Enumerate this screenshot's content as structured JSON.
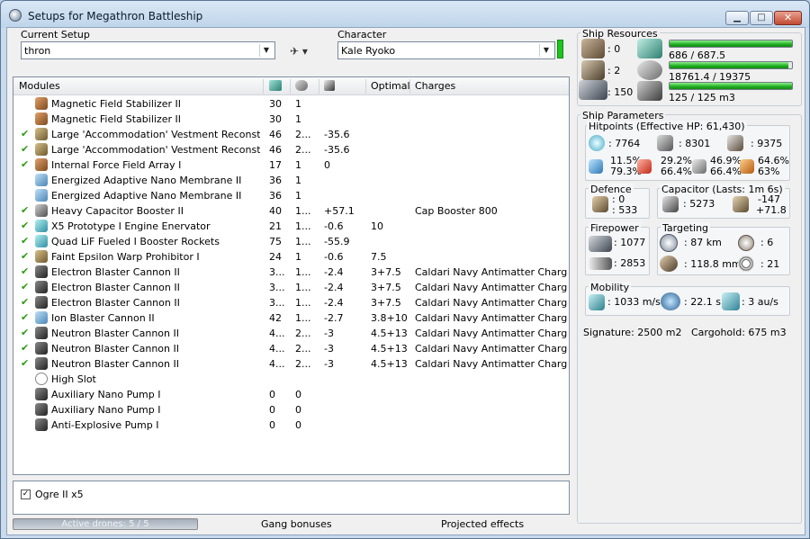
{
  "window": {
    "title": "Setups for Megathron Battleship",
    "min_glyph": "▁",
    "max_glyph": "□",
    "close_glyph": "✕"
  },
  "setup": {
    "label": "Current Setup",
    "value": "thron",
    "tool_glyph": "✈ ▾"
  },
  "character": {
    "label": "Character",
    "value": "Kale Ryoko"
  },
  "modules": {
    "headers": {
      "name": "Modules",
      "optimal": "Optimal",
      "charges": "Charges"
    },
    "rows": [
      {
        "checked": false,
        "icon": "ic-brown",
        "name": "Magnetic Field Stabilizer II",
        "c1": "30",
        "c2": "1",
        "c3": "",
        "optimal": "",
        "charges": ""
      },
      {
        "checked": false,
        "icon": "ic-brown",
        "name": "Magnetic Field Stabilizer II",
        "c1": "30",
        "c2": "1",
        "c3": "",
        "optimal": "",
        "charges": ""
      },
      {
        "checked": true,
        "icon": "ic-tan",
        "name": "Large 'Accommodation' Vestment Reconstructer I",
        "c1": "46",
        "c2": "2...",
        "c3": "-35.6",
        "optimal": "",
        "charges": ""
      },
      {
        "checked": true,
        "icon": "ic-tan",
        "name": "Large 'Accommodation' Vestment Reconstructer I",
        "c1": "46",
        "c2": "2...",
        "c3": "-35.6",
        "optimal": "",
        "charges": ""
      },
      {
        "checked": true,
        "icon": "ic-brown",
        "name": "Internal Force Field Array I",
        "c1": "17",
        "c2": "1",
        "c3": "0",
        "optimal": "",
        "charges": ""
      },
      {
        "checked": false,
        "icon": "ic-blue",
        "name": "Energized Adaptive Nano Membrane II",
        "c1": "36",
        "c2": "1",
        "c3": "",
        "optimal": "",
        "charges": ""
      },
      {
        "checked": false,
        "icon": "ic-blue",
        "name": "Energized Adaptive Nano Membrane II",
        "c1": "36",
        "c2": "1",
        "c3": "",
        "optimal": "",
        "charges": ""
      },
      {
        "checked": true,
        "icon": "ic-grey",
        "name": "Heavy Capacitor Booster II",
        "c1": "40",
        "c2": "1...",
        "c3": "+57.1",
        "optimal": "",
        "charges": "Cap Booster 800"
      },
      {
        "checked": true,
        "icon": "ic-teal",
        "name": "X5 Prototype I Engine Enervator",
        "c1": "21",
        "c2": "1...",
        "c3": "-0.6",
        "optimal": "10",
        "charges": ""
      },
      {
        "checked": true,
        "icon": "ic-teal",
        "name": "Quad LiF Fueled I Booster Rockets",
        "c1": "75",
        "c2": "1...",
        "c3": "-55.9",
        "optimal": "",
        "charges": ""
      },
      {
        "checked": true,
        "icon": "ic-tan",
        "name": "Faint Epsilon Warp Prohibitor I",
        "c1": "24",
        "c2": "1",
        "c3": "-0.6",
        "optimal": "7.5",
        "charges": ""
      },
      {
        "checked": true,
        "icon": "ic-dark",
        "name": "Electron Blaster Cannon II",
        "c1": "3...",
        "c2": "1...",
        "c3": "-2.4",
        "optimal": "3+7.5",
        "charges": "Caldari Navy Antimatter Charge L"
      },
      {
        "checked": true,
        "icon": "ic-dark",
        "name": "Electron Blaster Cannon II",
        "c1": "3...",
        "c2": "1...",
        "c3": "-2.4",
        "optimal": "3+7.5",
        "charges": "Caldari Navy Antimatter Charge L"
      },
      {
        "checked": true,
        "icon": "ic-dark",
        "name": "Electron Blaster Cannon II",
        "c1": "3...",
        "c2": "1...",
        "c3": "-2.4",
        "optimal": "3+7.5",
        "charges": "Caldari Navy Antimatter Charge L"
      },
      {
        "checked": true,
        "icon": "ic-blue",
        "name": "Ion Blaster Cannon II",
        "c1": "42",
        "c2": "1...",
        "c3": "-2.7",
        "optimal": "3.8+10",
        "charges": "Caldari Navy Antimatter Charge L"
      },
      {
        "checked": true,
        "icon": "ic-dark",
        "name": "Neutron Blaster Cannon II",
        "c1": "4...",
        "c2": "2...",
        "c3": "-3",
        "optimal": "4.5+13",
        "charges": "Caldari Navy Antimatter Charge L"
      },
      {
        "checked": true,
        "icon": "ic-dark",
        "name": "Neutron Blaster Cannon II",
        "c1": "4...",
        "c2": "2...",
        "c3": "-3",
        "optimal": "4.5+13",
        "charges": "Caldari Navy Antimatter Charge L"
      },
      {
        "checked": true,
        "icon": "ic-dark",
        "name": "Neutron Blaster Cannon II",
        "c1": "4...",
        "c2": "2...",
        "c3": "-3",
        "optimal": "4.5+13",
        "charges": "Caldari Navy Antimatter Charge L"
      },
      {
        "checked": false,
        "icon": "ic-slot",
        "name": "High Slot",
        "c1": "",
        "c2": "",
        "c3": "",
        "optimal": "",
        "charges": ""
      },
      {
        "checked": false,
        "icon": "ic-dark",
        "name": "Auxiliary Nano Pump I",
        "c1": "0",
        "c2": "0",
        "c3": "",
        "optimal": "",
        "charges": ""
      },
      {
        "checked": false,
        "icon": "ic-dark",
        "name": "Auxiliary Nano Pump I",
        "c1": "0",
        "c2": "0",
        "c3": "",
        "optimal": "",
        "charges": ""
      },
      {
        "checked": false,
        "icon": "ic-dark",
        "name": "Anti-Explosive Pump I",
        "c1": "0",
        "c2": "0",
        "c3": "",
        "optimal": "",
        "charges": ""
      }
    ]
  },
  "drones": {
    "item": "Ogre II x5",
    "checked_glyph": "✓"
  },
  "status": {
    "active_drones": "Active drones: 5 / 5",
    "active_drones_fraction": 1.0,
    "gang": "Gang bonuses",
    "projected": "Projected effects"
  },
  "resources": {
    "title": "Ship Resources",
    "turret": ": 0",
    "launcher": ": 2",
    "calibration": ": 150",
    "cpu": {
      "text": "686 / 687.5",
      "fraction": 0.998
    },
    "powergrid": {
      "text": "18761.4 / 19375",
      "fraction": 0.968
    },
    "drone_bay": {
      "text": "125 / 125 m3",
      "fraction": 1.0
    }
  },
  "params": {
    "title": "Ship Parameters",
    "hitpoints": {
      "title": "Hitpoints (Effective HP: 61,430)",
      "shield": ": 7764",
      "armor": ": 8301",
      "hull": ": 9375",
      "res_a1": "11.5%",
      "res_a2": "79.3%",
      "res_b1": "29.2%",
      "res_b2": "66.4%",
      "res_c1": "46.9%",
      "res_c2": "66.4%",
      "res_d1": "64.6%",
      "res_d2": "63%"
    },
    "defence": {
      "title": "Defence",
      "v1": ": 0",
      "v2": ": 533"
    },
    "capacitor": {
      "title": "Capacitor (Lasts: 1m 6s)",
      "amount": ": 5273",
      "d1": "-147",
      "d2": "+71.8"
    },
    "firepower": {
      "title": "Firepower",
      "turret": ": 1077",
      "drone": ": 2853"
    },
    "targeting": {
      "title": "Targeting",
      "range": ": 87 km",
      "targets": ": 6",
      "resolution": ": 118.8 mm",
      "sensor": ": 21"
    },
    "mobility": {
      "title": "Mobility",
      "speed": ": 1033 m/s",
      "align": ": 22.1 s",
      "warp": ": 3 au/s"
    },
    "signature": "Signature: 2500 m2",
    "cargohold": "Cargohold: 675 m3"
  }
}
